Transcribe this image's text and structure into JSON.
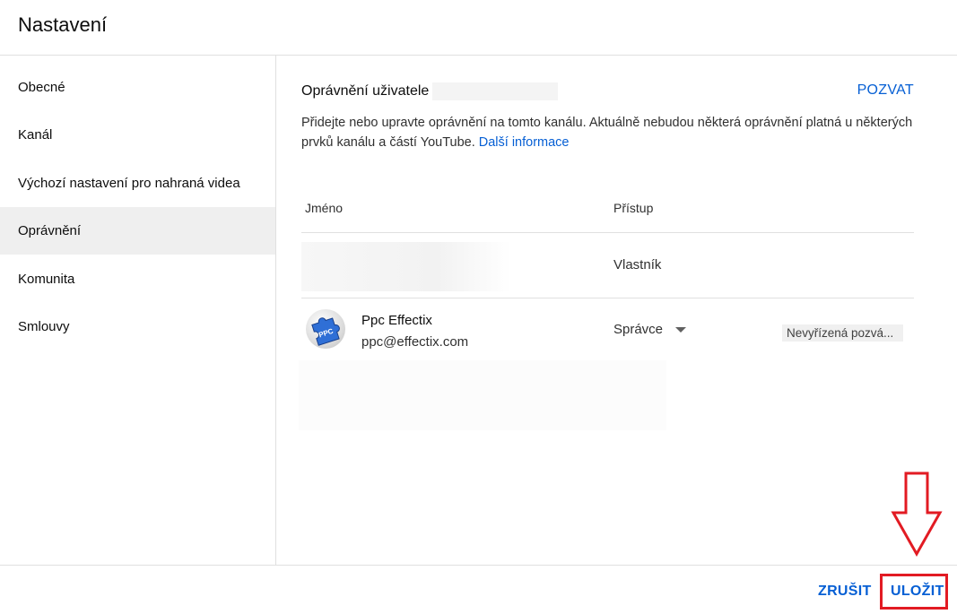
{
  "header": {
    "title": "Nastavení"
  },
  "sidebar": {
    "items": [
      {
        "label": "Obecné"
      },
      {
        "label": "Kanál"
      },
      {
        "label": "Výchozí nastavení pro nahraná videa"
      },
      {
        "label": "Oprávnění"
      },
      {
        "label": "Komunita"
      },
      {
        "label": "Smlouvy"
      }
    ],
    "active_index": 3
  },
  "main": {
    "section_title": "Oprávnění uživatele",
    "invite_label": "POZVAT",
    "description": "Přidejte nebo upravte oprávnění na tomto kanálu. Aktuálně nebudou některá oprávnění platná u některých prvků kanálu a částí YouTube.",
    "learn_more": "Další informace",
    "table": {
      "col_name": "Jméno",
      "col_access": "Přístup",
      "rows": [
        {
          "name": "",
          "email": "",
          "role": "Vlastník"
        },
        {
          "name": "Ppc Effectix",
          "email": "ppc@effectix.com",
          "role": "Správce",
          "status": "Nevyřízená pozvá..."
        }
      ]
    },
    "avatar_text": "PPC"
  },
  "footer": {
    "cancel_label": "ZRUŠIT",
    "save_label": "ULOŽIT"
  },
  "colors": {
    "accent": "#065fd4",
    "annotation": "#e21b23",
    "active_bg": "#efefef"
  }
}
